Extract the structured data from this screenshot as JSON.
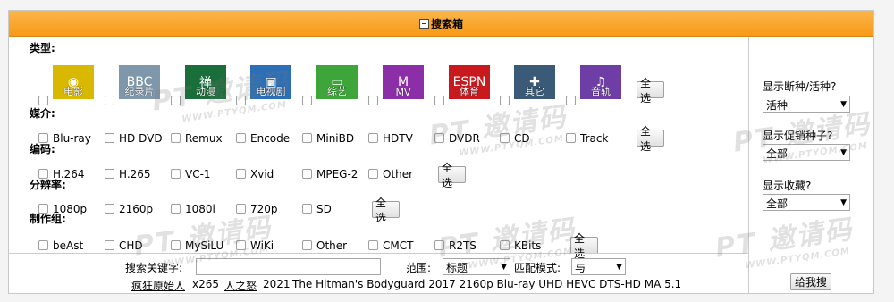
{
  "header": {
    "title": "搜索箱"
  },
  "sections": {
    "type": "类型:",
    "media": "媒介:",
    "codec": "编码:",
    "resolution": "分辨率:",
    "group": "制作组:"
  },
  "categories": [
    {
      "name": "电影",
      "bg": "#d8b800",
      "glyph": "◉"
    },
    {
      "name": "纪录片",
      "bg": "#7f97aa",
      "glyph": "BBC"
    },
    {
      "name": "动漫",
      "bg": "#1a6e3a",
      "glyph": "禅"
    },
    {
      "name": "电视剧",
      "bg": "#2c6fb6",
      "glyph": "▣"
    },
    {
      "name": "综艺",
      "bg": "#3ea53a",
      "glyph": "▭"
    },
    {
      "name": "MV",
      "bg": "#8c2ea8",
      "glyph": "M"
    },
    {
      "name": "体育",
      "bg": "#c8191e",
      "glyph": "ESPN"
    },
    {
      "name": "其它",
      "bg": "#3a5a78",
      "glyph": "✚"
    },
    {
      "name": "音轨",
      "bg": "#6e3ea6",
      "glyph": "♫"
    }
  ],
  "media": [
    "Blu-ray",
    "HD DVD",
    "Remux",
    "Encode",
    "MiniBD",
    "HDTV",
    "DVDR",
    "CD",
    "Track"
  ],
  "codec": [
    "H.264",
    "H.265",
    "VC-1",
    "Xvid",
    "MPEG-2",
    "Other"
  ],
  "resolution": [
    "1080p",
    "2160p",
    "1080i",
    "720p",
    "SD"
  ],
  "groups": [
    "beAst",
    "CHD",
    "MySiLU",
    "WiKi",
    "Other",
    "CMCT",
    "R2TS",
    "KBits"
  ],
  "select_all": "全选",
  "right": {
    "dead_label": "显示断种/活种?",
    "dead_value": "活种",
    "promo_label": "显示促销种子?",
    "promo_value": "全部",
    "fav_label": "显示收藏?",
    "fav_value": "全部",
    "submit": "给我搜"
  },
  "search": {
    "keyword_label": "搜索关键字:",
    "keyword_value": "",
    "scope_label": "范围:",
    "scope_value": "标题",
    "match_label": "匹配模式:",
    "match_value": "与"
  },
  "hot": [
    "疯狂原始人",
    "x265",
    "人之怒",
    "2021",
    "The Hitman's Bodyguard 2017 2160p Blu-ray UHD HEVC DTS-HD MA 5.1"
  ],
  "watermark": {
    "main": "PT 邀请码",
    "sub": "WWW.PTYQM.COM"
  }
}
